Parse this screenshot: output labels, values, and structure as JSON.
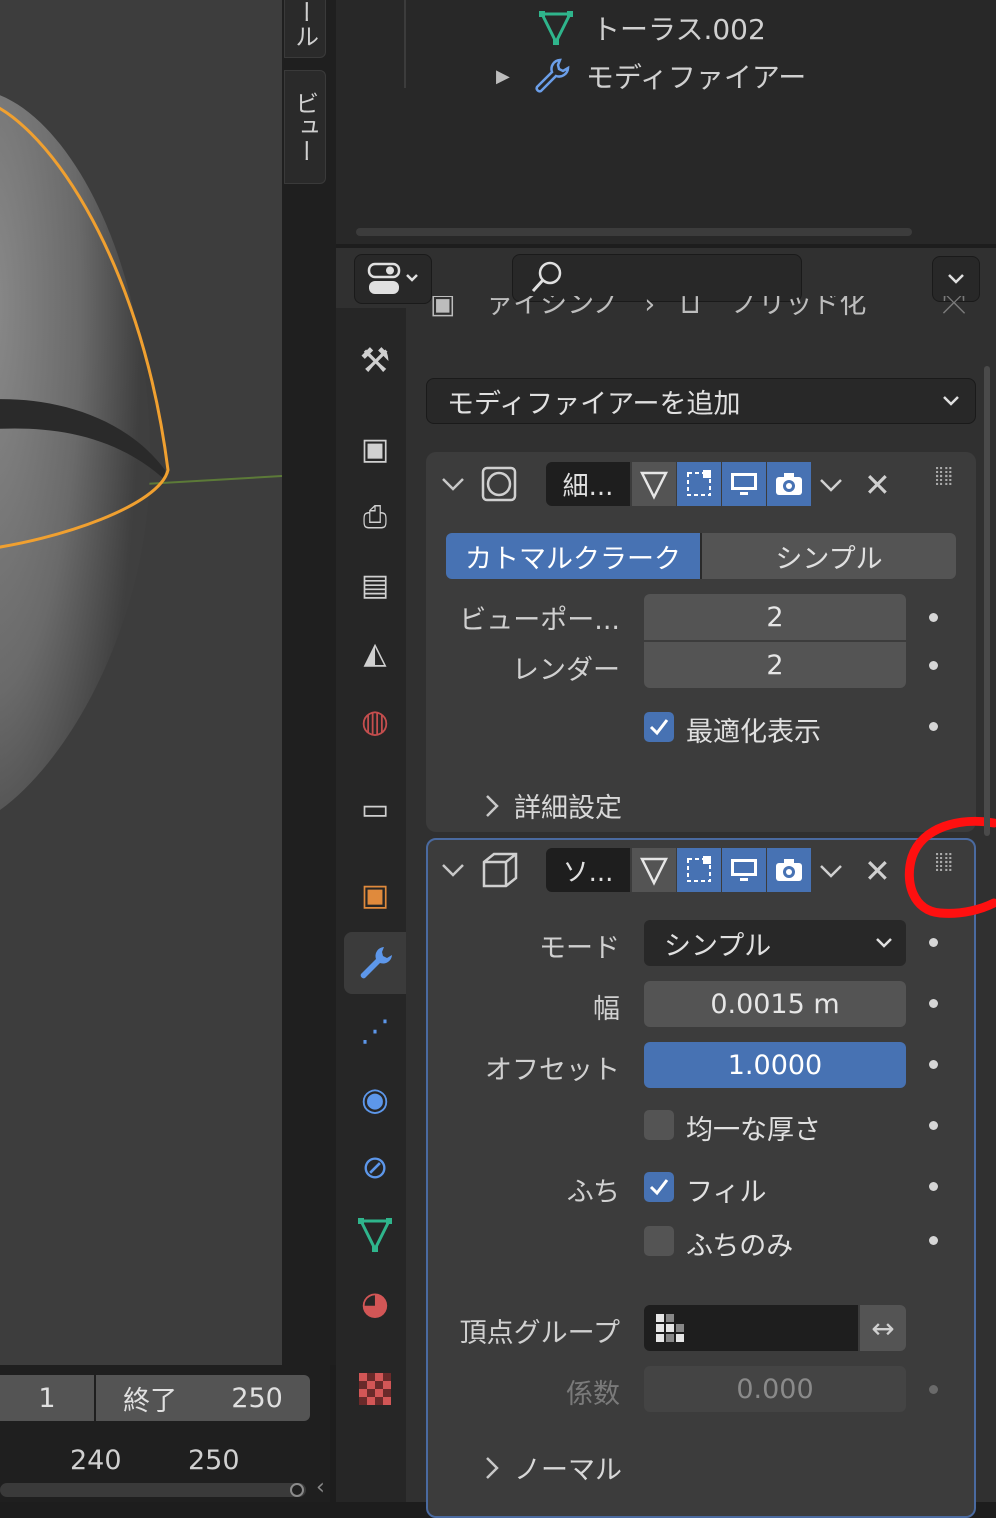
{
  "viewport": {
    "tabs": [
      "ール",
      "ビュー"
    ]
  },
  "outliner": {
    "rows": [
      {
        "label": "トーラス.002",
        "icon": "mesh-data-icon"
      },
      {
        "label": "モディファイアー",
        "icon": "wrench-icon"
      }
    ]
  },
  "breadcrumb": {
    "items": [
      "ァイシンノ",
      "ノリッド化"
    ]
  },
  "add_modifier": {
    "label": "モディファイアーを追加"
  },
  "subsurf": {
    "name": "細...",
    "toggle": {
      "active": "カトマルクラーク",
      "other": "シンプル"
    },
    "viewport_label": "ビューポー...",
    "viewport_value": "2",
    "render_label": "レンダー",
    "render_value": "2",
    "optimal_label": "最適化表示",
    "advanced_label": "詳細設定"
  },
  "solidify": {
    "name": "ソ...",
    "mode_label": "モード",
    "mode_value": "シンプル",
    "thickness_label": "幅",
    "thickness_value": "0.0015 m",
    "offset_label": "オフセット",
    "offset_value": "1.0000",
    "even_label": "均一な厚さ",
    "rim_label": "ふち",
    "fill_label": "フィル",
    "rim_only_label": "ふちのみ",
    "vgroup_label": "頂点グループ",
    "factor_label": "係数",
    "factor_value": "0.000",
    "normals_label": "ノーマル"
  },
  "timeline": {
    "start_value": "1",
    "end_label": "終了",
    "end_value": "250",
    "ticks": [
      "240",
      "250"
    ]
  },
  "colors": {
    "accent": "#4772b3",
    "selection": "#f0a030",
    "annotation": "#ff0000"
  }
}
